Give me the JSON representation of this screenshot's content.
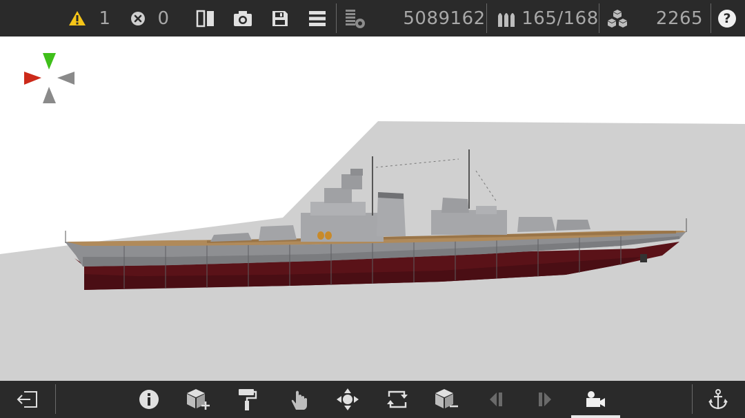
{
  "topbar": {
    "warnings_count": "1",
    "errors_count": "0",
    "mass_value": "5089162",
    "ammo_value": "165/168",
    "blocks_value": "2265",
    "help_label": "?"
  },
  "icons": {
    "warning": "warning-triangle-icon",
    "error": "error-circle-icon",
    "mirror": "mirror-icon",
    "camera": "camera-icon",
    "save": "save-icon",
    "menu": "menu-icon",
    "mass": "mass-icon",
    "ammo": "ammo-icon",
    "blocks": "blocks-icon",
    "help": "help-icon",
    "exit": "exit-icon",
    "info": "info-icon",
    "add_block": "add-block-icon",
    "paint": "paint-roller-icon",
    "hand": "hand-icon",
    "move": "move-icon",
    "rotate": "rotate-icon",
    "remove_block": "remove-block-icon",
    "prev": "previous-icon",
    "next": "next-icon",
    "camera_mode": "camera-mode-icon",
    "anchor": "anchor-icon"
  },
  "colors": {
    "bar_background": "#2a2a2a",
    "icon_color": "#d0d0d0",
    "warning_yellow": "#f5c518",
    "gizmo_green": "#3fbf1a",
    "gizmo_red": "#cc2a1a",
    "gizmo_gray": "#8a8a8a",
    "hull_gray": "#8e8f92",
    "hull_red": "#5a1218"
  }
}
